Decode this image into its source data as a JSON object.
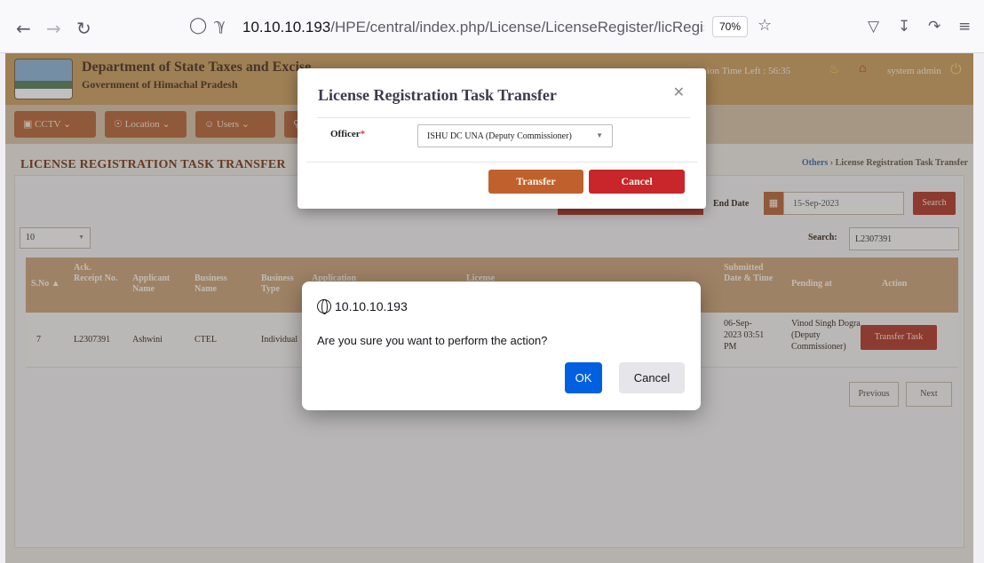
{
  "browser": {
    "url_host": "10.10.10.193",
    "url_path": "/HPE/central/index.php/License/LicenseRegister/licRegisterTaskTra",
    "zoom": "70%"
  },
  "header": {
    "dept_title": "Department of State Taxes and Excise",
    "dept_subtitle": "Government of Himachal Pradesh",
    "session": "ion Time Left : 56:35",
    "user": "system admin"
  },
  "menu": {
    "cctv": "CCTV",
    "location": "Location",
    "users": "Users"
  },
  "page": {
    "title": "LICENSE REGISTRATION TASK TRANSFER",
    "breadcrumb_link": "Others",
    "breadcrumb_current": "License Registration Task Transfer",
    "page_size": "10",
    "end_date_label": "End Date",
    "end_date": "15-Sep-2023",
    "search_button": "Search",
    "search_label": "Search:",
    "search_value": "L2307391"
  },
  "table": {
    "headers": {
      "sno": "S.No",
      "ack": "Ack. Receipt No.",
      "applicant": "Applicant Name",
      "business": "Business Name",
      "btype": "Business Type",
      "application": "Application",
      "license": "License",
      "submitted": "Submitted Date & Time",
      "pending": "Pending at",
      "action": "Action"
    },
    "row": {
      "sno": "7",
      "ack": "L2307391",
      "applicant": "Ashwini",
      "business": "CTEL",
      "btype": "Individual",
      "submitted": "06-Sep-2023 03:51 PM",
      "pending": "Vinod Singh Dogra (Deputy Commissioner)",
      "action": "Transfer Task"
    },
    "previous": "Previous",
    "next": "Next"
  },
  "modal": {
    "title": "License Registration Task Transfer",
    "officer_label": "Officer",
    "officer_required": "*",
    "officer_value": "ISHU DC UNA (Deputy Commissioner)",
    "transfer": "Transfer",
    "cancel": "Cancel"
  },
  "confirm": {
    "origin": "10.10.10.193",
    "message": "Are you sure you want to perform the action?",
    "ok": "OK",
    "cancel": "Cancel"
  }
}
